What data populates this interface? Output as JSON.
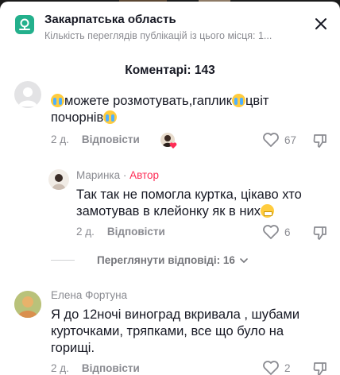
{
  "location": {
    "title": "Закарпатська область",
    "subtitle": "Кількість переглядів публікацій із цього місця: 1...",
    "icon": "map-pin-icon"
  },
  "comments_header": "Коментарі: 143",
  "colors": {
    "accent": "#fe2c55",
    "location_icon": "#23b08c",
    "muted": "#8a8b91"
  },
  "comments": [
    {
      "text_main": "можете розмотувать,гаплик",
      "text_tail": "цвіт почорнів",
      "date": "2 д.",
      "reply_label": "Відповісти",
      "likes": "67"
    },
    {
      "username": "Маринка",
      "author_label": "Автор",
      "text": "Так так не помогла куртка, цікаво хто замотував в клейонку як в них",
      "date": "2 д.",
      "reply_label": "Відповісти",
      "likes": "6"
    },
    {
      "username": "Елена Фортуна",
      "text": "Я до 12ночі виноград вкривала , шубами курточками, тряпками, все що було на горищі.",
      "date": "2 д.",
      "reply_label": "Відповісти",
      "likes": "2"
    }
  ],
  "view_replies": "Переглянути відповіді: 16"
}
